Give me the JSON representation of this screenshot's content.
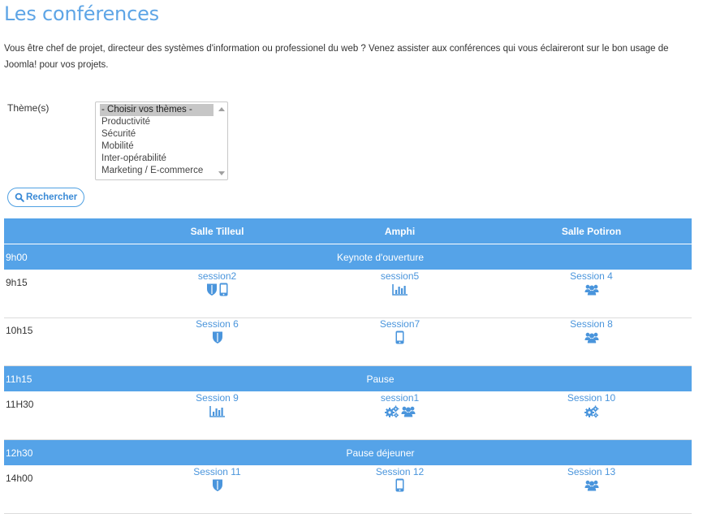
{
  "page": {
    "title": "Les conférences",
    "intro": "Vous être chef de projet, directeur des systèmes d'information ou professionel du web ? Venez assister aux conférences qui vous éclaireront sur le bon usage de Joomla! pour vos projets."
  },
  "filter": {
    "label": "Thème(s)",
    "options": [
      "- Choisir vos thèmes -",
      "Productivité",
      "Sécurité",
      "Mobilité",
      "Inter-opérabilité",
      "Marketing / E-commerce"
    ],
    "selected_index": 0,
    "search_label": "Rechercher"
  },
  "schedule": {
    "columns": [
      "",
      "Salle Tilleul",
      "Amphi",
      "Salle Potiron"
    ],
    "rows": [
      {
        "type": "band",
        "time": "9h00",
        "label": "Keynote d'ouverture"
      },
      {
        "type": "sessions",
        "time": "9h15",
        "cells": [
          {
            "name": "session2",
            "icons": [
              "shield-icon",
              "mobile-icon"
            ]
          },
          {
            "name": "session5",
            "icons": [
              "bar-chart-icon"
            ]
          },
          {
            "name": "Session 4",
            "icons": [
              "users-icon"
            ]
          }
        ]
      },
      {
        "type": "sessions",
        "time": "10h15",
        "cells": [
          {
            "name": "Session 6",
            "icons": [
              "shield-icon"
            ]
          },
          {
            "name": "Session7",
            "icons": [
              "mobile-icon"
            ]
          },
          {
            "name": "Session 8",
            "icons": [
              "users-icon"
            ]
          }
        ]
      },
      {
        "type": "band",
        "time": "11h15",
        "label": "Pause"
      },
      {
        "type": "sessions",
        "time": "11H30",
        "cells": [
          {
            "name": "Session 9",
            "icons": [
              "bar-chart-icon"
            ]
          },
          {
            "name": "session1",
            "icons": [
              "gears-icon",
              "users-icon"
            ]
          },
          {
            "name": "Session 10",
            "icons": [
              "gears-icon"
            ]
          }
        ]
      },
      {
        "type": "band",
        "time": "12h30",
        "label": "Pause déjeuner"
      },
      {
        "type": "sessions",
        "time": "14h00",
        "cells": [
          {
            "name": "Session 11",
            "icons": [
              "shield-icon"
            ]
          },
          {
            "name": "Session 12",
            "icons": [
              "mobile-icon"
            ]
          },
          {
            "name": "Session 13",
            "icons": [
              "users-icon"
            ]
          }
        ]
      }
    ]
  },
  "colors": {
    "accent": "#55a3e8",
    "title": "#5ea5e6",
    "link": "#4a95dc",
    "icon": "#4a95dc"
  }
}
